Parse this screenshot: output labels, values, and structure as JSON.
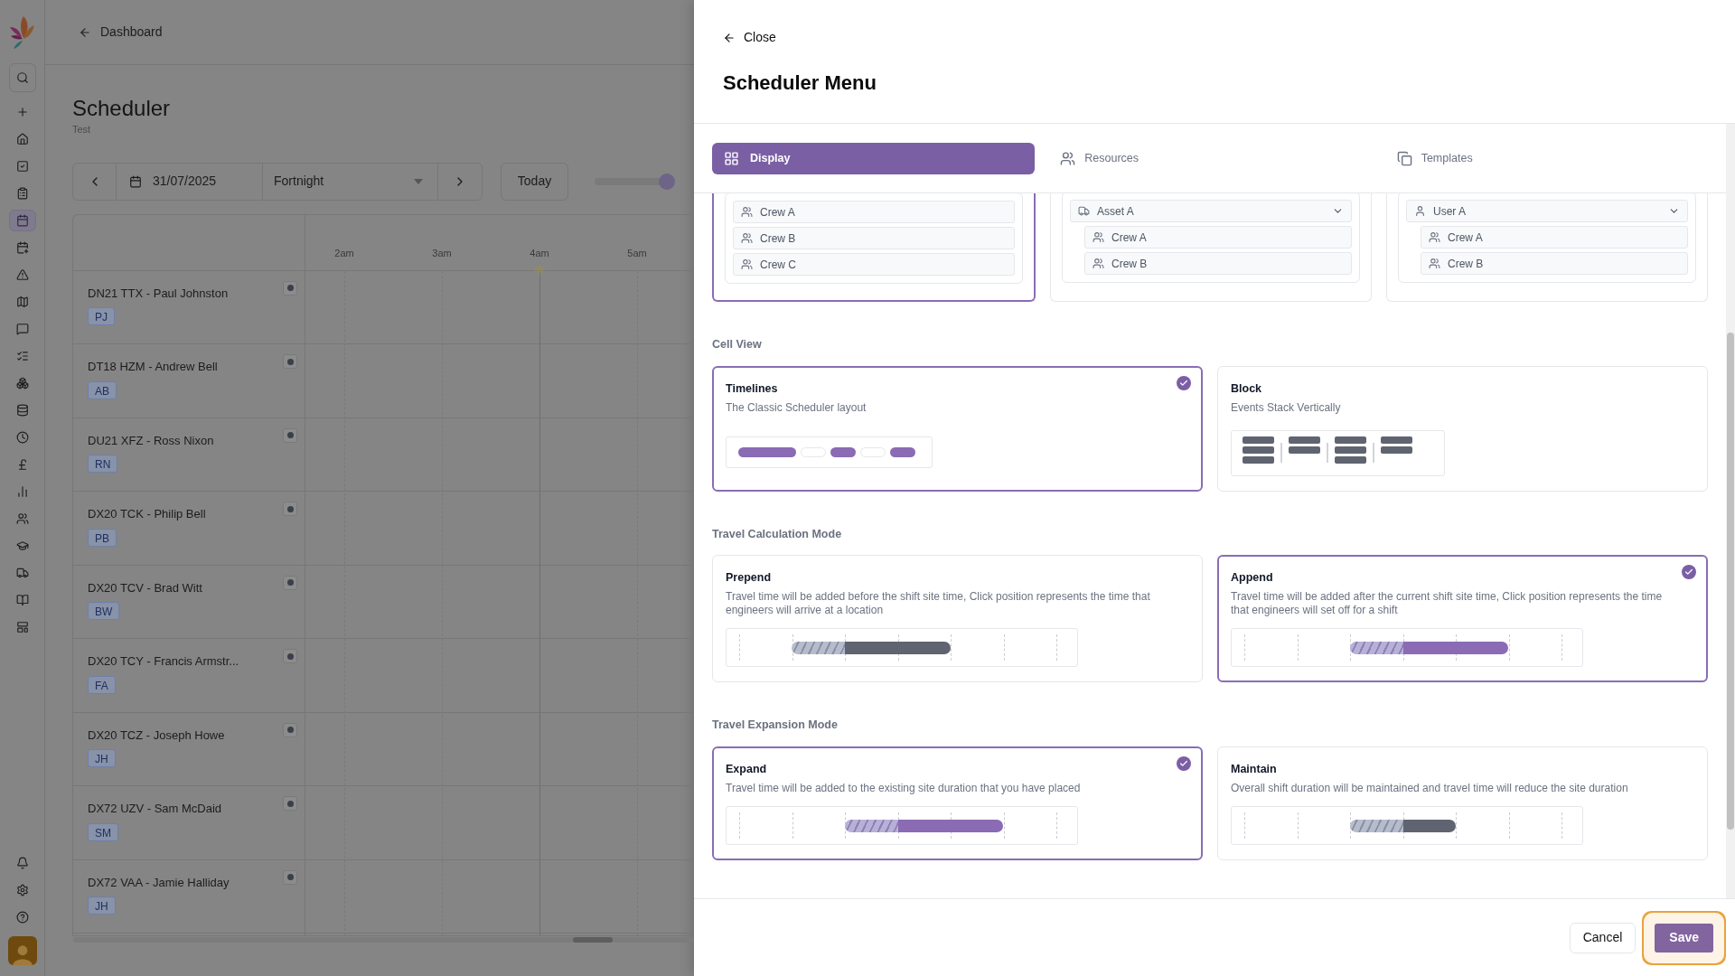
{
  "nav_items": [
    {
      "selected": false
    },
    {
      "selected": false
    },
    {
      "selected": false
    },
    {
      "selected": false
    },
    {
      "selected": true
    },
    {
      "selected": false
    },
    {
      "selected": false
    },
    {
      "selected": false
    },
    {
      "selected": false
    },
    {
      "selected": false
    },
    {
      "selected": false
    },
    {
      "selected": false
    },
    {
      "selected": false
    },
    {
      "selected": false
    },
    {
      "selected": false
    },
    {
      "selected": false
    },
    {
      "selected": false
    },
    {
      "selected": false
    },
    {
      "selected": false
    },
    {
      "selected": false
    }
  ],
  "back_link": "Dashboard",
  "page": {
    "title": "Scheduler",
    "subtitle": "Test"
  },
  "toolbar": {
    "date": "31/07/2025",
    "view": "Fortnight",
    "today": "Today",
    "zoom_slider": {
      "level": 0.93
    }
  },
  "timeline": {
    "hours": [
      "2am",
      "3am",
      "4am",
      "5am"
    ]
  },
  "rows": [
    {
      "name": "DN21 TTX - Paul Johnston",
      "initials": "PJ"
    },
    {
      "name": "DT18 HZM - Andrew Bell",
      "initials": "AB"
    },
    {
      "name": "DU21 XFZ - Ross Nixon",
      "initials": "RN"
    },
    {
      "name": "DX20 TCK - Philip Bell",
      "initials": "PB"
    },
    {
      "name": "DX20 TCV - Brad Witt",
      "initials": "BW"
    },
    {
      "name": "DX20 TCY - Francis Armstr...",
      "initials": "FA"
    },
    {
      "name": "DX20 TCZ - Joseph Howe",
      "initials": "JH"
    },
    {
      "name": "DX72 UZV - Sam McDaid",
      "initials": "SM"
    },
    {
      "name": "DX72 VAA - Jamie Halliday",
      "initials": "JH"
    }
  ],
  "panel": {
    "close": "Close",
    "title": "Scheduler Menu",
    "tabs": [
      {
        "label": "Display",
        "selected": true
      },
      {
        "label": "Resources",
        "selected": false
      },
      {
        "label": "Templates",
        "selected": false
      }
    ],
    "layout_options": [
      {
        "kind": "list",
        "selected": true,
        "rows": [
          "Crew A",
          "Crew B",
          "Crew C"
        ]
      },
      {
        "kind": "grouped",
        "selected": false,
        "group": {
          "kind": "asset",
          "label": "Asset A"
        },
        "rows": [
          "Crew A",
          "Crew B"
        ]
      },
      {
        "kind": "grouped",
        "selected": false,
        "group": {
          "kind": "user",
          "label": "User A"
        },
        "rows": [
          "Crew A",
          "Crew B"
        ]
      }
    ],
    "sections": [
      {
        "title": "Cell View",
        "options": [
          {
            "kind": "timelines",
            "title": "Timelines",
            "description": "The Classic Scheduler layout",
            "selected": true
          },
          {
            "kind": "block",
            "title": "Block",
            "description": "Events Stack Vertically",
            "selected": false
          }
        ]
      },
      {
        "title": "Travel Calculation Mode",
        "options": [
          {
            "kind": "prepend",
            "title": "Prepend",
            "description": "Travel time will be added before the shift site time, Click position represents the time that engineers will arrive at a location",
            "selected": false
          },
          {
            "kind": "append",
            "title": "Append",
            "description": "Travel time will be added after the current shift site time, Click position represents the time that engineers will set off for a shift",
            "selected": true
          }
        ]
      },
      {
        "title": "Travel Expansion Mode",
        "options": [
          {
            "kind": "expand",
            "title": "Expand",
            "description": "Travel time will be added to the existing site duration that you have placed",
            "selected": true
          },
          {
            "kind": "maintain",
            "title": "Maintain",
            "description": "Overall shift duration will be maintained and travel time will reduce the site duration",
            "selected": false
          }
        ]
      }
    ],
    "footer": {
      "cancel": "Cancel",
      "save": {
        "label": "Save",
        "focused": true
      }
    }
  }
}
